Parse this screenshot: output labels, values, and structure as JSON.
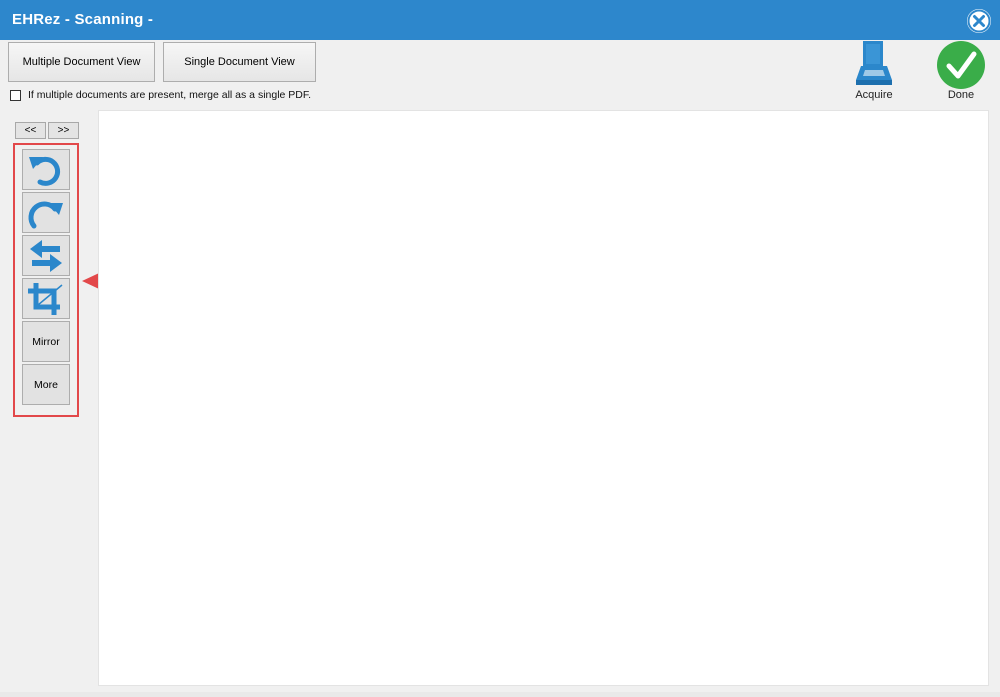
{
  "window": {
    "title": "EHRez - Scanning -",
    "close_icon": "close-circle-icon"
  },
  "toolbar": {
    "multiple_view_label": "Multiple Document View",
    "single_view_label": "Single Document View",
    "merge_checkbox_label": "If multiple documents are present, merge all as a single PDF.",
    "merge_checked": false,
    "acquire_label": "Acquire",
    "acquire_icon": "scanner-icon",
    "done_label": "Done",
    "done_icon": "checkmark-icon"
  },
  "sidebar": {
    "prev_label": "<<",
    "next_label": ">>",
    "tools": [
      {
        "name": "rotate-left",
        "icon": "rotate-left-icon"
      },
      {
        "name": "rotate-right",
        "icon": "rotate-right-icon"
      },
      {
        "name": "swap",
        "icon": "swap-arrows-icon"
      },
      {
        "name": "crop",
        "icon": "crop-icon"
      }
    ],
    "mirror_label": "Mirror",
    "more_label": "More"
  },
  "colors": {
    "titlebar": "#2d87cc",
    "icon_blue": "#2b87cb",
    "done_green": "#3aad49",
    "highlight_red": "#e2484a"
  }
}
